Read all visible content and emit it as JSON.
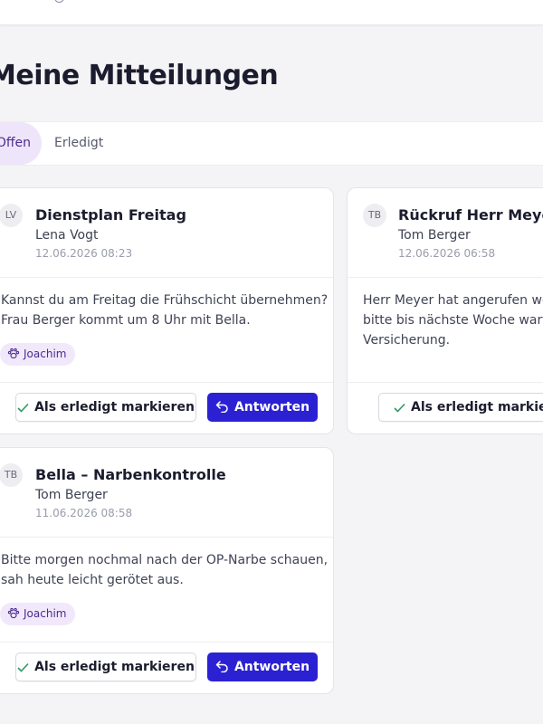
{
  "page": {
    "title": "Meine Mitteilungen"
  },
  "tabs": [
    {
      "label": "Offen",
      "active": true
    },
    {
      "label": "Erledigt",
      "active": false
    }
  ],
  "cards": [
    {
      "initials": "LV",
      "title": "Dienstplan Freitag",
      "author": "Lena Vogt",
      "time": "12.06.2026 08:23",
      "body": [
        "Kannst du am Freitag die Frühschicht übernehmen?",
        "Frau Berger kommt um 8 Uhr mit Bella."
      ],
      "tag": "Joachim",
      "done_label": "Als erledigt markieren",
      "reply_label": "Antworten"
    },
    {
      "initials": "TB",
      "title": "Rückruf Herr Meyer",
      "author": "Tom Berger",
      "time": "12.06.2026 06:58",
      "body": [
        "Herr Meyer hat angerufen weg",
        "bitte bis nächste Woche warte",
        "Versicherung."
      ],
      "done_label": "Als erledigt markiere"
    },
    {
      "initials": "TB",
      "title": "Bella – Narbenkontrolle",
      "author": "Tom Berger",
      "time": "11.06.2026 08:58",
      "body": [
        "Bitte morgen nochmal nach der OP-Narbe schauen,",
        "sah heute leicht gerötet aus."
      ],
      "tag": "Joachim",
      "done_label": "Als erledigt markieren",
      "reply_label": "Antworten"
    }
  ],
  "colors": {
    "accent": "#2b21d3",
    "tag_bg": "#f2e8fc",
    "tag_text": "#4a2c8c",
    "check": "#2e9a63"
  }
}
